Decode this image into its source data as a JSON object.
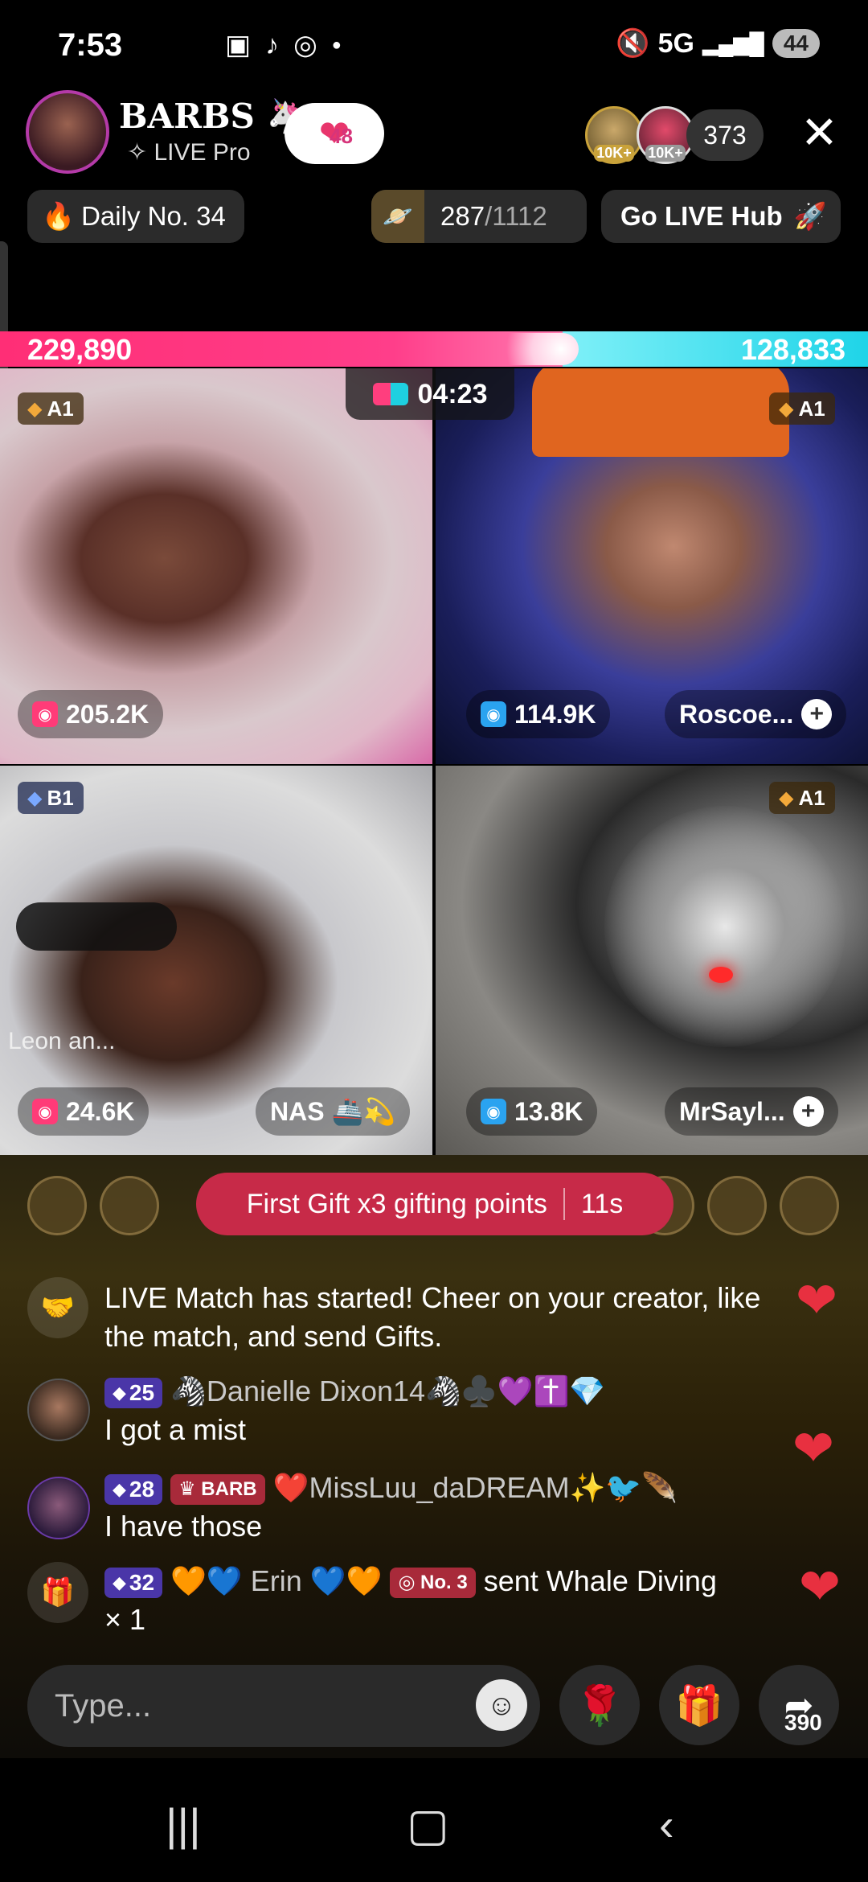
{
  "status_bar": {
    "time": "7:53",
    "app_icons": [
      "screenshot-icon",
      "tiktok-icon",
      "instagram-icon",
      "dot"
    ],
    "network": "5G",
    "battery": "44"
  },
  "host": {
    "name": "BARBS 🦄",
    "subtitle": "LIVE Pro",
    "likes_badge": "48",
    "viewer_count": "373",
    "viewer_badges": [
      "10K+",
      "10K+"
    ]
  },
  "pills": {
    "daily": "Daily No. 34",
    "score_current": "287",
    "score_total": "/1112",
    "go_live_hub": "Go LIVE Hub"
  },
  "match": {
    "left_score": "229,890",
    "right_score": "128,833",
    "timer": "04:23",
    "left_color": "#ff2e76",
    "right_color": "#1fd4e8"
  },
  "tiles": [
    {
      "tier": "A1",
      "points": "205.2K",
      "name": "",
      "point_color": "pink"
    },
    {
      "tier": "A1",
      "points": "114.9K",
      "name": "Roscoe...",
      "point_color": "blue"
    },
    {
      "tier": "B1",
      "points": "24.6K",
      "name": "NAS 🚢💫",
      "overlay": "Leon an...",
      "point_color": "pink"
    },
    {
      "tier": "A1",
      "points": "13.8K",
      "name": "MrSayl...",
      "point_color": "blue"
    }
  ],
  "gift_banner": {
    "text": "First Gift x3 gifting points",
    "countdown": "11s"
  },
  "chat": [
    {
      "type": "system",
      "text": "LIVE Match has started! Cheer on your creator, like the match, and send Gifts."
    },
    {
      "level": "25",
      "user": "🦓Danielle Dixon14🦓♣️💜✝️💎",
      "message": "I got a mist"
    },
    {
      "level": "28",
      "tag": "BARB",
      "user": "❤️MissLuu_daDREAM✨🐦🪶",
      "message": "I have those"
    },
    {
      "level": "32",
      "user": "🧡💙 Erin 💙🧡",
      "rank": "No. 3",
      "message": "sent Whale Diving",
      "count": "× 1"
    }
  ],
  "input": {
    "placeholder": "Type...",
    "share_count": "390"
  },
  "nav": {
    "recents": "recents-icon",
    "home": "home-icon",
    "back": "back-icon"
  }
}
